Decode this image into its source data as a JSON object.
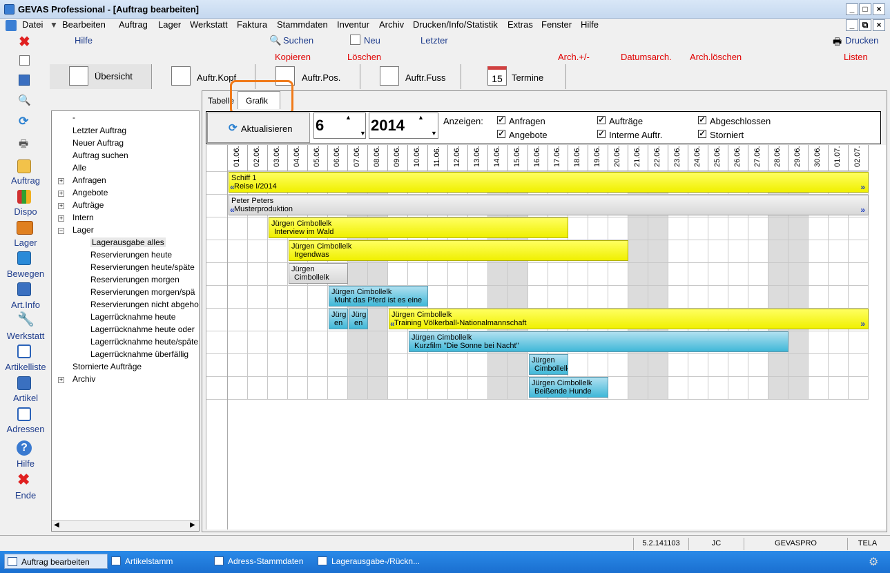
{
  "window": {
    "title": "GEVAS Professional - [Auftrag bearbeiten]"
  },
  "menu": [
    "Datei",
    "Bearbeiten",
    "Auftrag",
    "Lager",
    "Werkstatt",
    "Faktura",
    "Stammdaten",
    "Inventur",
    "Archiv",
    "Drucken/Info/Statistik",
    "Extras",
    "Fenster",
    "Hilfe"
  ],
  "toolbar": {
    "hilfe": "Hilfe",
    "suchen": "Suchen",
    "neu": "Neu",
    "letzter": "Letzter",
    "drucken": "Drucken",
    "kopieren": "Kopieren",
    "loeschen": "Löschen",
    "arch_plus": "Arch.+/-",
    "datumsarch": "Datumsarch.",
    "arch_loeschen": "Arch.löschen",
    "listen": "Listen"
  },
  "tabs": [
    "Übersicht",
    "Auftr.Kopf",
    "Auftr.Pos.",
    "Auftr.Fuss",
    "Termine"
  ],
  "termine_day": "15",
  "leftnav": [
    "Auftrag",
    "Dispo",
    "Lager",
    "Bewegen",
    "Art.Info",
    "Werkstatt",
    "Artikelliste",
    "Artikel",
    "Adressen",
    "Hilfe",
    "Ende"
  ],
  "tree": {
    "items": [
      "-",
      "Letzter Auftrag",
      "Neuer Auftrag",
      "Auftrag suchen",
      "Alle",
      "Anfragen",
      "Angebote",
      "Aufträge",
      "Intern",
      "Lager"
    ],
    "lager_children": [
      "Lagerausgabe alles",
      "Reservierungen heute",
      "Reservierungen heute/späte",
      "Reservierungen morgen",
      "Reservierungen morgen/spä",
      "Reservierungen nicht abgeho",
      "Lagerrücknahme heute",
      "Lagerrücknahme heute oder",
      "Lagerrücknahme heute/späte",
      "Lagerrücknahme überfällig"
    ],
    "after": [
      "Stornierte Aufträge",
      "Archiv"
    ]
  },
  "subtabs": {
    "tabelle": "Tabelle",
    "grafik": "Grafik"
  },
  "controls": {
    "refresh": "Aktualisieren",
    "month": "6",
    "year": "2014",
    "anzeigen": "Anzeigen:"
  },
  "checks": [
    {
      "label": "Anfragen",
      "checked": true
    },
    {
      "label": "Aufträge",
      "checked": true
    },
    {
      "label": "Abgeschlossen",
      "checked": true
    },
    {
      "label": "Angebote",
      "checked": true
    },
    {
      "label": "Interme Auftr.",
      "checked": true
    },
    {
      "label": "Storniert",
      "checked": true
    }
  ],
  "days": [
    "01.06.",
    "02.06.",
    "03.06.",
    "04.06.",
    "05.06.",
    "06.06.",
    "07.06.",
    "08.06.",
    "09.06.",
    "10.06.",
    "11.06.",
    "12.06.",
    "13.06.",
    "14.06.",
    "15.06.",
    "16.06.",
    "17.06.",
    "18.06.",
    "19.06.",
    "20.06.",
    "21.06.",
    "22.06.",
    "23.06.",
    "24.06.",
    "25.06.",
    "26.06.",
    "27.06.",
    "28.06.",
    "29.06.",
    "30.06.",
    "01.07.",
    "02.07."
  ],
  "weekend_days": [
    7,
    8,
    14,
    15,
    21,
    22,
    28,
    29
  ],
  "bars": [
    {
      "row": 0,
      "start": 1,
      "end": 32,
      "color": "yellow",
      "l1": "Schiff 1",
      "l2": "Reise I/2014",
      "arrows": true
    },
    {
      "row": 1,
      "start": 1,
      "end": 32,
      "color": "grayb",
      "l1": "Peter Peters",
      "l2": "Musterproduktion",
      "arrows": true
    },
    {
      "row": 2,
      "start": 3,
      "end": 17,
      "color": "yellow",
      "l1": "Jürgen Cimbollelk",
      "l2": "Interview im Wald"
    },
    {
      "row": 3,
      "start": 4,
      "end": 20,
      "color": "yellow",
      "l1": "Jürgen Cimbollelk",
      "l2": "Irgendwas"
    },
    {
      "row": 4,
      "start": 4,
      "end": 6,
      "color": "grayb",
      "l1": "Jürgen",
      "l2": "Cimbollelk"
    },
    {
      "row": 5,
      "start": 6,
      "end": 10,
      "color": "cyan",
      "l1": "Jürgen Cimbollelk",
      "l2": "Muht das Pferd ist es eine"
    },
    {
      "row": 6,
      "start": 6,
      "end": 6,
      "color": "cyan",
      "l1": "Jürg",
      "l2": "en"
    },
    {
      "row": 6,
      "start": 7,
      "end": 7,
      "color": "cyan",
      "l1": "Jürg",
      "l2": "en"
    },
    {
      "row": 6,
      "start": 9,
      "end": 32,
      "color": "yellow",
      "l1": "Jürgen Cimbollelk",
      "l2": "Training Völkerball-Nationalmannschaft",
      "arrows": true
    },
    {
      "row": 7,
      "start": 10,
      "end": 28,
      "color": "cyan",
      "l1": "Jürgen Cimbollelk",
      "l2": "Kurzfilm \"Die Sonne bei Nacht\""
    },
    {
      "row": 8,
      "start": 16,
      "end": 17,
      "color": "cyan",
      "l1": "Jürgen",
      "l2": "Cimbollelk"
    },
    {
      "row": 9,
      "start": 16,
      "end": 19,
      "color": "cyan",
      "l1": "Jürgen Cimbollelk",
      "l2": "Beißende Hunde"
    }
  ],
  "status": [
    "5.2.141103",
    "JC",
    "GEVASPRO",
    "TELA"
  ],
  "taskbar": [
    "Auftrag bearbeiten",
    "Artikelstamm",
    "Adress-Stammdaten",
    "Lagerausgabe-/Rückn..."
  ],
  "colors": {
    "accent_red": "#e00000",
    "nav_blue": "#1e3c8c",
    "highlight_ring": "#f07a1a"
  }
}
